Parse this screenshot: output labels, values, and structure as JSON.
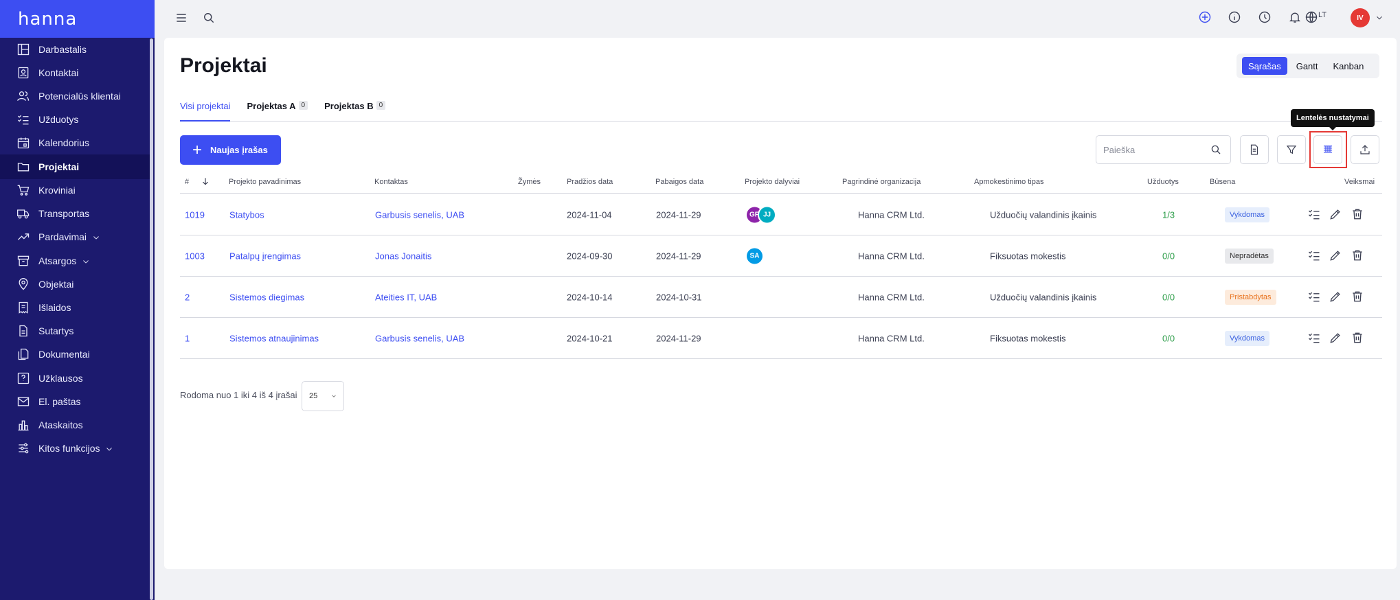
{
  "brand": "hanna",
  "sidebar": {
    "items": [
      {
        "label": "Darbastalis",
        "icon": "dashboard-icon"
      },
      {
        "label": "Kontaktai",
        "icon": "contacts-icon"
      },
      {
        "label": "Potencialūs klientai",
        "icon": "leads-icon"
      },
      {
        "label": "Užduotys",
        "icon": "tasks-icon"
      },
      {
        "label": "Kalendorius",
        "icon": "calendar-icon"
      },
      {
        "label": "Projektai",
        "icon": "folder-icon",
        "active": true
      },
      {
        "label": "Kroviniai",
        "icon": "cart-icon"
      },
      {
        "label": "Transportas",
        "icon": "truck-icon"
      },
      {
        "label": "Pardavimai",
        "icon": "trend-icon",
        "expandable": true
      },
      {
        "label": "Atsargos",
        "icon": "inventory-icon",
        "expandable": true
      },
      {
        "label": "Objektai",
        "icon": "location-pin-icon"
      },
      {
        "label": "Išlaidos",
        "icon": "expenses-icon"
      },
      {
        "label": "Sutartys",
        "icon": "contract-icon"
      },
      {
        "label": "Dokumentai",
        "icon": "documents-icon"
      },
      {
        "label": "Užklausos",
        "icon": "inquiry-icon"
      },
      {
        "label": "El. paštas",
        "icon": "mail-icon"
      },
      {
        "label": "Ataskaitos",
        "icon": "reports-icon"
      },
      {
        "label": "Kitos funkcijos",
        "icon": "settings-sliders-icon",
        "expandable": true
      }
    ]
  },
  "topbar": {
    "lang": "LT",
    "user_initials": "IV"
  },
  "page": {
    "title": "Projektai",
    "views": [
      "Sąrašas",
      "Gantt",
      "Kanban"
    ],
    "active_view": "Sąrašas"
  },
  "tabs": [
    {
      "label": "Visi projektai",
      "count": null,
      "active": true
    },
    {
      "label": "Projektas A",
      "count": "0"
    },
    {
      "label": "Projektas B",
      "count": "0"
    }
  ],
  "toolbar": {
    "new_label": "Naujas įrašas",
    "search_placeholder": "Paieška",
    "tooltip": "Lentelės nustatymai"
  },
  "table": {
    "headers": [
      "#",
      "Projekto pavadinimas",
      "Kontaktas",
      "Žymės",
      "Pradžios data",
      "Pabaigos data",
      "Projekto dalyviai",
      "Pagrindinė organizacija",
      "Apmokestinimo tipas",
      "Užduotys",
      "Būsena",
      "Veiksmai"
    ],
    "rows": [
      {
        "id": "1019",
        "name": "Statybos",
        "contact": "Garbusis senelis, UAB",
        "start": "2024-11-04",
        "end": "2024-11-29",
        "members": [
          {
            "initials": "GR",
            "color": "#8e24aa"
          },
          {
            "initials": "JJ",
            "color": "#00acc1"
          }
        ],
        "org": "Hanna CRM Ltd.",
        "billing": "Užduočių valandinis įkainis",
        "tasks": "1/3",
        "status": "Vykdomas",
        "status_style": "blue"
      },
      {
        "id": "1003",
        "name": "Patalpų įrengimas",
        "contact": "Jonas Jonaitis",
        "start": "2024-09-30",
        "end": "2024-11-29",
        "members": [
          {
            "initials": "SA",
            "color": "#039be5"
          }
        ],
        "org": "Hanna CRM Ltd.",
        "billing": "Fiksuotas mokestis",
        "tasks": "0/0",
        "status": "Nepradėtas",
        "status_style": "gray"
      },
      {
        "id": "2",
        "name": "Sistemos diegimas",
        "contact": "Ateities IT, UAB",
        "start": "2024-10-14",
        "end": "2024-10-31",
        "members": [],
        "org": "Hanna CRM Ltd.",
        "billing": "Užduočių valandinis įkainis",
        "tasks": "0/0",
        "status": "Pristabdytas",
        "status_style": "orange"
      },
      {
        "id": "1",
        "name": "Sistemos atnaujinimas",
        "contact": "Garbusis senelis, UAB",
        "start": "2024-10-21",
        "end": "2024-11-29",
        "members": [],
        "org": "Hanna CRM Ltd.",
        "billing": "Fiksuotas mokestis",
        "tasks": "0/0",
        "status": "Vykdomas",
        "status_style": "blue"
      }
    ]
  },
  "footer": {
    "showing": "Rodoma nuo 1 iki 4 iš 4 įrašai",
    "page_size": "25"
  },
  "colors": {
    "accent": "#3d4ef2",
    "sidebar": "#1c1a6e",
    "highlight": "#e53935"
  }
}
